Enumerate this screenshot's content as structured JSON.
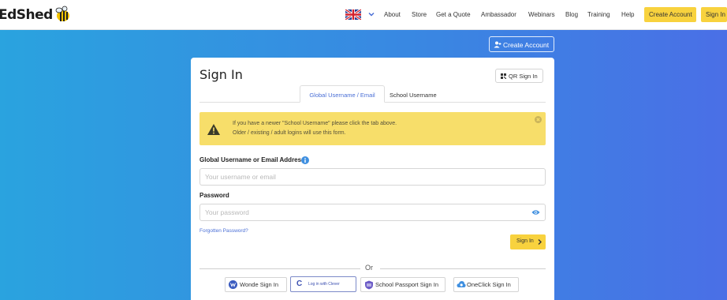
{
  "header": {
    "logo_text": "EdShed",
    "nav": [
      "About",
      "Store",
      "Get a Quote",
      "Ambassador",
      "Webinars",
      "Blog",
      "Training",
      "Help"
    ],
    "create_account": "Create Account",
    "sign_in": "Sign In"
  },
  "create_account_button": "Create Account",
  "card": {
    "title": "Sign In",
    "qr_button": "QR Sign In",
    "tabs": [
      "Global Username / Email",
      "School Username"
    ],
    "alert": {
      "line1": "If you have a newer \"School Username\" please click the tab above.",
      "line2": "Older / existing / adult logins will use this form."
    },
    "username_label": "Global Username or Email Address",
    "username_placeholder": "Your username or email",
    "password_label": "Password",
    "password_placeholder": "Your password",
    "forgot": "Forgotten Password?",
    "signin_button": "Sign In",
    "or": "Or",
    "sso": {
      "wonde": "Wonde Sign In",
      "clever_letter": "C",
      "clever": "Log in with Clever",
      "school_passport": "School Passport Sign In",
      "oneclick": "OneClick Sign In"
    }
  },
  "colors": {
    "accent_yellow": "#f8d23e",
    "link_blue": "#4a6fd6",
    "alert_yellow": "#f7de6a"
  }
}
